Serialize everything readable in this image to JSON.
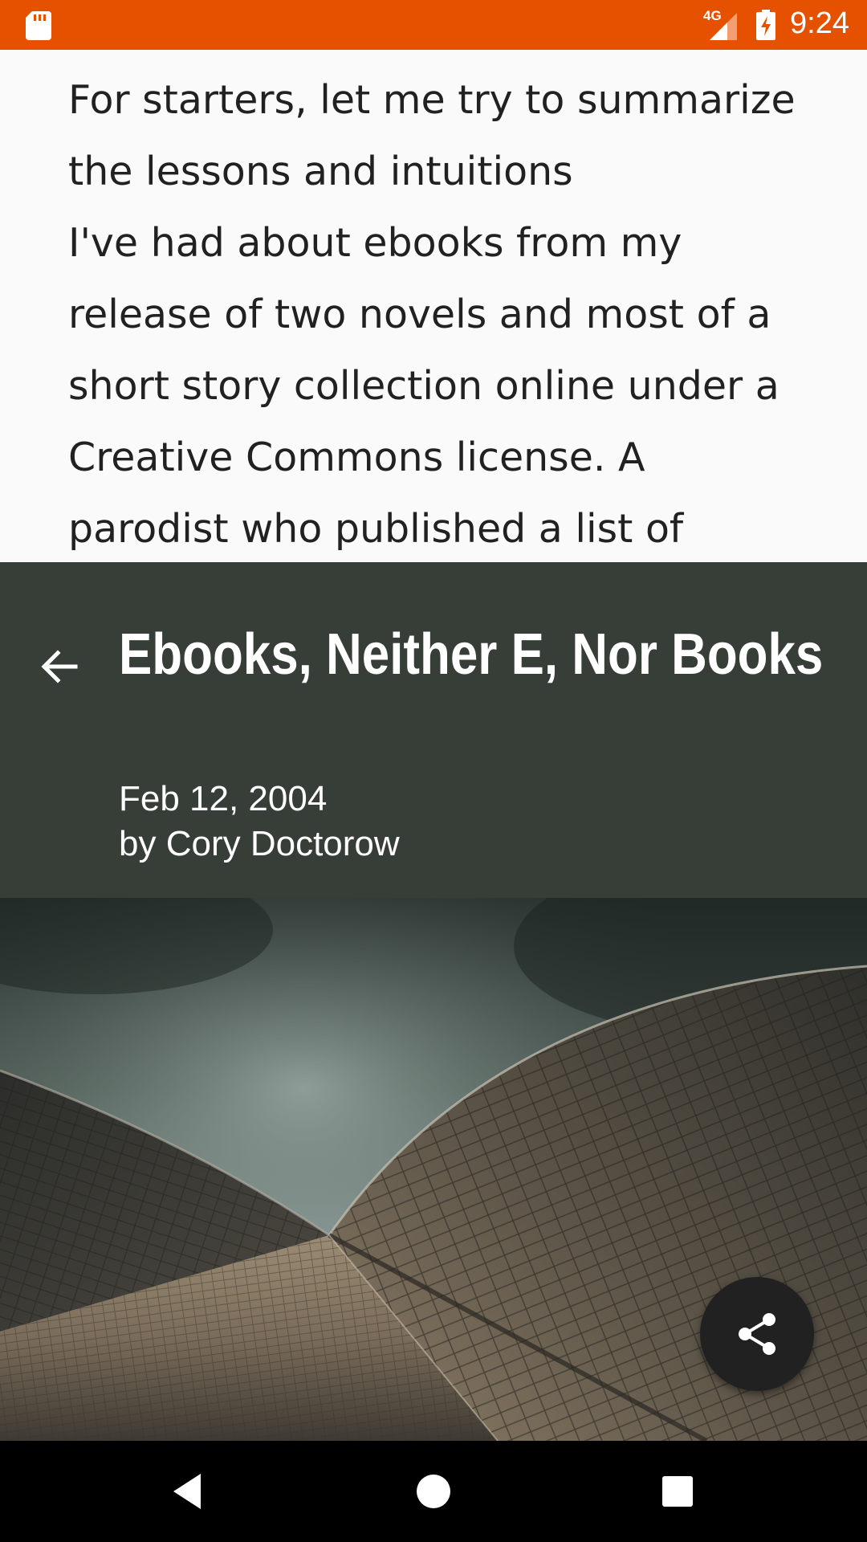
{
  "status_bar": {
    "network": "4G",
    "time": "9:24",
    "background": "#e65100",
    "icons": [
      "sd-card-icon",
      "signal-icon",
      "battery-charging-icon"
    ]
  },
  "article": {
    "body_lines": [
      "For starters, let me try to summarize",
      "the lessons and intuitions",
      "I've had about ebooks from my",
      "release of two novels and most of a",
      "short story collection online under a",
      "Creative Commons license. A",
      "parodist who published a list of"
    ],
    "title": "Ebooks, Neither E, Nor Books",
    "date": "Feb 12, 2004",
    "author": "by Cory Doctorow",
    "header_background": "#373e38"
  },
  "actions": {
    "back_icon": "arrow-left-icon",
    "share_icon": "share-icon"
  },
  "nav_bar": {
    "buttons": [
      "back-triangle-icon",
      "home-circle-icon",
      "recents-square-icon"
    ]
  }
}
